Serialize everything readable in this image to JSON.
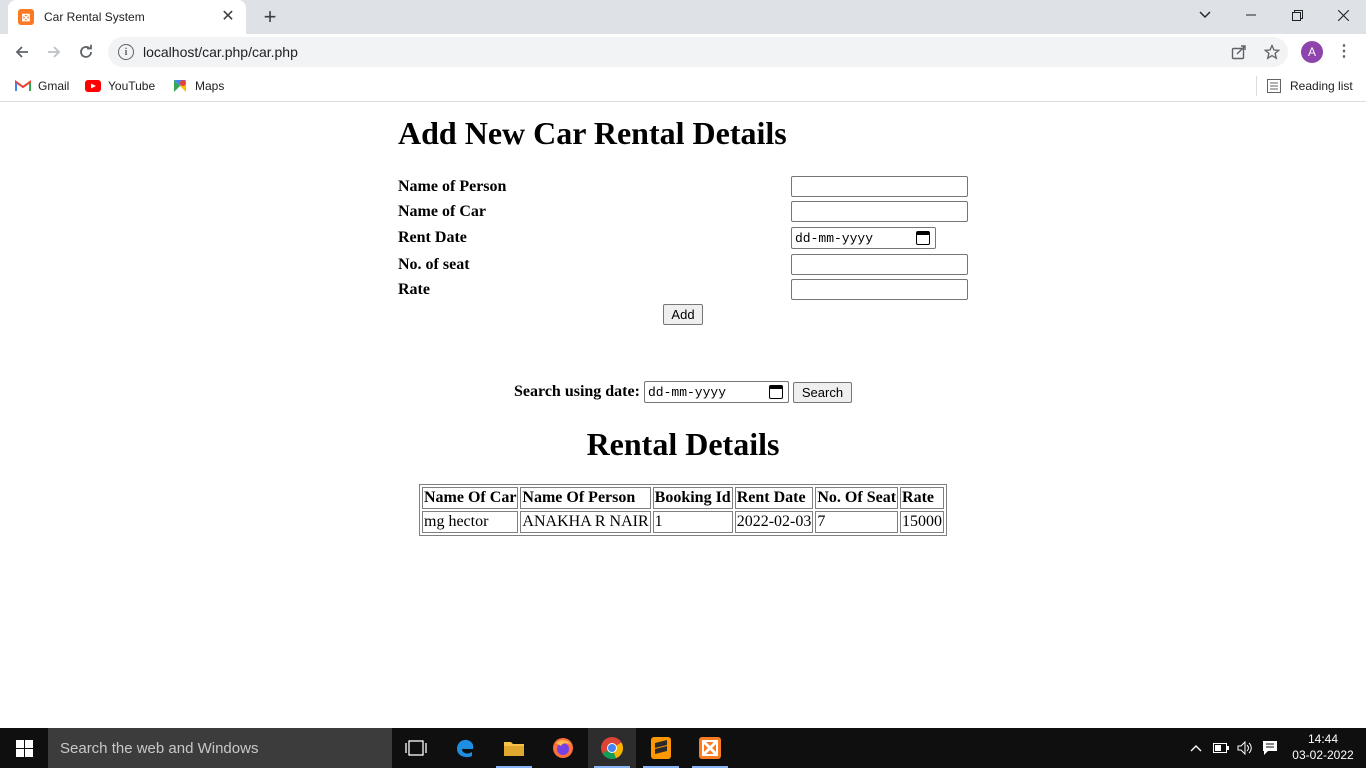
{
  "browser": {
    "tab_title": "Car Rental System",
    "tab_close": "✕",
    "new_tab": "+",
    "url": "localhost/car.php/car.php",
    "avatar_letter": "A",
    "bookmarks": [
      {
        "label": "Gmail",
        "icon": "gmail-icon"
      },
      {
        "label": "YouTube",
        "icon": "youtube-icon"
      },
      {
        "label": "Maps",
        "icon": "maps-icon"
      }
    ],
    "reading_list": "Reading list"
  },
  "form": {
    "heading": "Add New Car Rental Details",
    "fields": {
      "person": {
        "label": "Name of Person",
        "value": ""
      },
      "car": {
        "label": "Name of Car",
        "value": ""
      },
      "rent_date": {
        "label": "Rent Date",
        "placeholder": "dd-mm-yyyy"
      },
      "seats": {
        "label": "No. of seat",
        "value": ""
      },
      "rate": {
        "label": "Rate",
        "value": ""
      }
    },
    "add_button": "Add"
  },
  "search": {
    "label": "Search using date:",
    "placeholder": "dd-mm-yyyy",
    "button": "Search"
  },
  "rental": {
    "heading": "Rental Details",
    "columns": [
      "Name Of Car",
      "Name Of Person",
      "Booking Id",
      "Rent Date",
      "No. Of Seat",
      "Rate"
    ],
    "rows": [
      [
        "mg hector",
        "ANAKHA R NAIR",
        "1",
        "2022-02-03",
        "7",
        "15000"
      ]
    ]
  },
  "taskbar": {
    "search_placeholder": "Search the web and Windows",
    "time": "14:44",
    "date": "03-02-2022"
  },
  "colors": {
    "tabstrip": "#dee1e6",
    "avatar": "#8e44ad",
    "xampp": "#fb7a24",
    "taskbar": "#0f0f0f"
  }
}
